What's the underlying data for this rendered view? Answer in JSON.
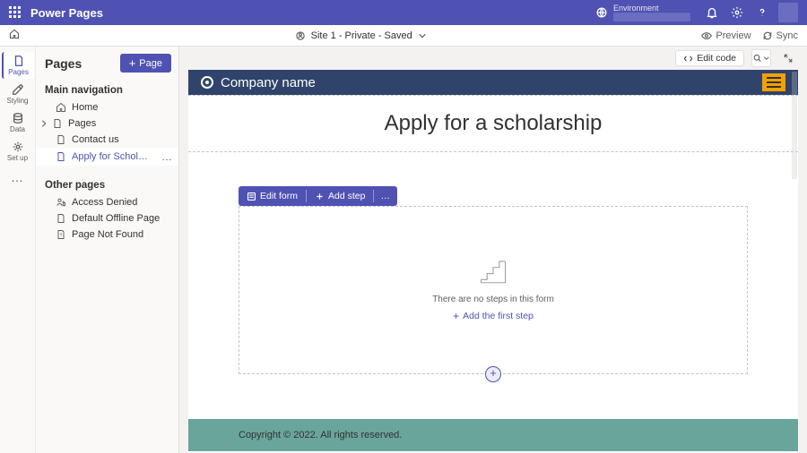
{
  "appbar": {
    "product": "Power Pages",
    "env_label": "Environment"
  },
  "cmdbar": {
    "site_status": "Site 1 - Private - Saved",
    "preview": "Preview",
    "sync": "Sync"
  },
  "rail": {
    "pages": "Pages",
    "styling": "Styling",
    "data": "Data",
    "setup": "Set up"
  },
  "pane": {
    "title": "Pages",
    "new_page": "Page",
    "main_nav": "Main navigation",
    "other_pages": "Other pages",
    "items": {
      "home": "Home",
      "pages": "Pages",
      "contact": "Contact us",
      "apply": "Apply for Scholars...",
      "access_denied": "Access Denied",
      "offline": "Default Offline Page",
      "notfound": "Page Not Found"
    }
  },
  "canvas_tools": {
    "edit_code": "Edit code"
  },
  "site": {
    "company": "Company name",
    "page_title": "Apply for a scholarship",
    "form": {
      "edit": "Edit form",
      "add_step": "Add step",
      "empty": "There are no steps in this form",
      "add_first": "Add the first step"
    },
    "footer": "Copyright © 2022. All rights reserved."
  }
}
